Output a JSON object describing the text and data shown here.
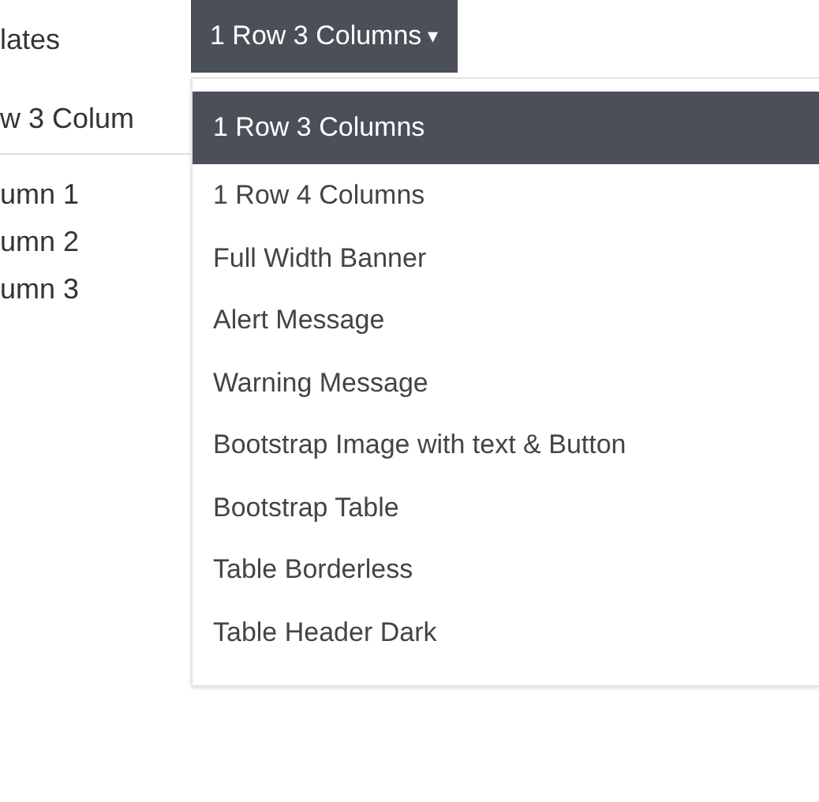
{
  "left_panel": {
    "heading": "lates",
    "tab": "w 3 Colum",
    "items": [
      "umn 1",
      "umn 2",
      "umn 3"
    ]
  },
  "dropdown": {
    "label": "1 Row 3 Columns",
    "caret": "▾",
    "items": [
      {
        "label": "1 Row 3 Columns",
        "selected": true
      },
      {
        "label": "1 Row 4 Columns",
        "selected": false
      },
      {
        "label": "Full Width Banner",
        "selected": false
      },
      {
        "label": "Alert Message",
        "selected": false
      },
      {
        "label": "Warning Message",
        "selected": false
      },
      {
        "label": "Bootstrap Image with text & Button",
        "selected": false
      },
      {
        "label": "Bootstrap Table",
        "selected": false
      },
      {
        "label": "Table Borderless",
        "selected": false
      },
      {
        "label": "Table Header Dark",
        "selected": false
      }
    ]
  }
}
